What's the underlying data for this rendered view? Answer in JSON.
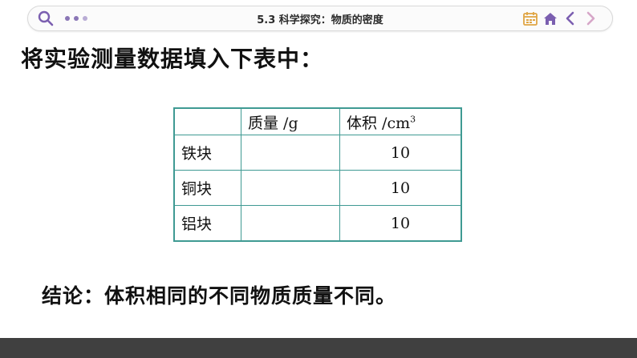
{
  "toolbar": {
    "title": "5.3 科学探究：物质的密度",
    "icons": [
      "search-icon",
      "more-dots-icon",
      "calendar-icon",
      "home-icon",
      "prev-arrow-icon",
      "next-arrow-icon"
    ],
    "accent_color": "#7b5fb0"
  },
  "slide": {
    "heading": "将实验测量数据填入下表中：",
    "table": {
      "columns": [
        "",
        "质量 /g",
        "体积 /cm",
        "3"
      ],
      "rows": [
        {
          "material": "铁块",
          "mass": "",
          "volume": "10"
        },
        {
          "material": "铜块",
          "mass": "",
          "volume": "10"
        },
        {
          "material": "铝块",
          "mass": "",
          "volume": "10"
        }
      ],
      "border_color": "#3f9a93"
    },
    "conclusion": "结论：体积相同的不同物质质量不同。"
  },
  "footer_color": "#404040"
}
